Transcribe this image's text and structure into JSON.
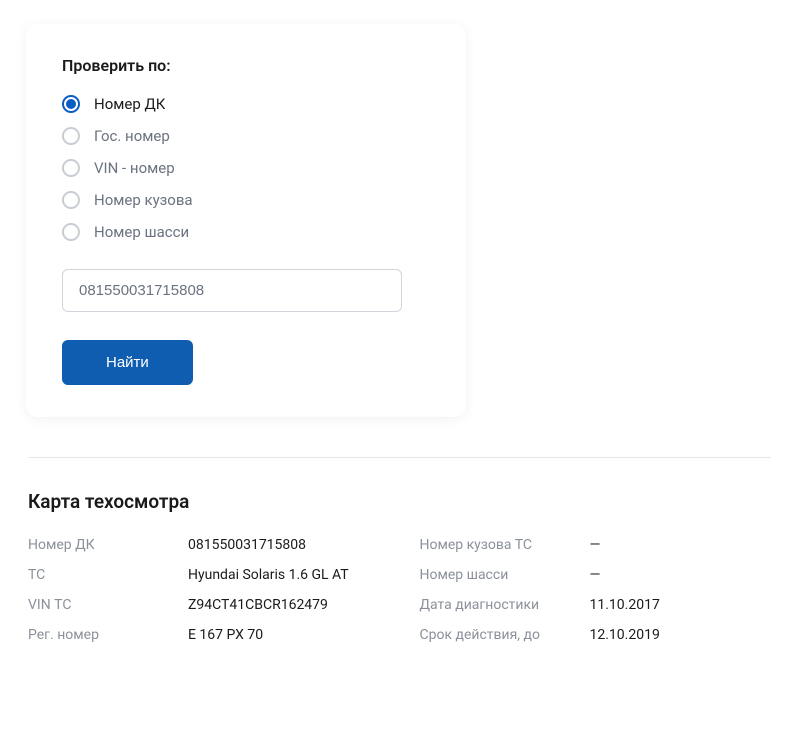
{
  "search": {
    "title": "Проверить по:",
    "options": [
      {
        "label": "Номер ДК",
        "selected": true
      },
      {
        "label": "Гос. номер",
        "selected": false
      },
      {
        "label": "VIN - номер",
        "selected": false
      },
      {
        "label": "Номер кузова",
        "selected": false
      },
      {
        "label": "Номер шасси",
        "selected": false
      }
    ],
    "input_value": "081550031715808",
    "button_label": "Найти"
  },
  "result": {
    "title": "Карта техосмотра",
    "left_rows": [
      {
        "label": "Номер ДК",
        "value": "081550031715808"
      },
      {
        "label": "ТС",
        "value": "Hyundai Solaris 1.6 GL AT"
      },
      {
        "label": "VIN ТС",
        "value": "Z94CT41CBCR162479"
      },
      {
        "label": "Рег. номер",
        "value": "Е 167 РХ 70"
      }
    ],
    "right_rows": [
      {
        "label": "Номер кузова ТС",
        "value": "—"
      },
      {
        "label": "Номер шасси",
        "value": "—"
      },
      {
        "label": "Дата диагностики",
        "value": "11.10.2017"
      },
      {
        "label": "Срок действия, до",
        "value": "12.10.2019"
      }
    ]
  }
}
